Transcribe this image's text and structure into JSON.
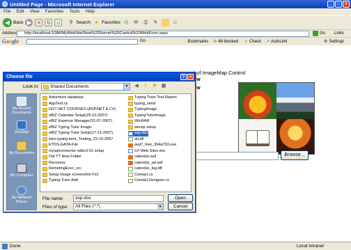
{
  "window": {
    "title": "Untitled Page - Microsoft Internet Explorer"
  },
  "menu": [
    "File",
    "Edit",
    "View",
    "Favorites",
    "Tools",
    "Help"
  ],
  "toolbar": {
    "back": "Back",
    "search": "Search",
    "favorites": "Favorites"
  },
  "address": {
    "label": "Address",
    "url": "http://localhost:1084/MyWebSite/New%20Server%20Control%20WebForm.aspx",
    "go": "Go",
    "links": "Links"
  },
  "google": {
    "logo": "Google",
    "go": "Go",
    "bookmarks": "Bookmarks",
    "blocked": "48 blocked",
    "check": "Check",
    "autolink": "AutoLink",
    "settings": "Settings"
  },
  "page": {
    "heading": "t of ImageMap Control",
    "browse": "Browse..."
  },
  "status": {
    "text": "Done",
    "zone": "Local intranet"
  },
  "dialog": {
    "title": "Choose file",
    "look_in_label": "Look in:",
    "look_in_value": "Shared Documents",
    "places": [
      "My Recent Documents",
      "Desktop",
      "My Documents",
      "My Computer",
      "My Network Places"
    ],
    "files_col1": [
      {
        "name": "Adventure database",
        "type": "folder"
      },
      {
        "name": "AppTest.cs",
        "type": "folder"
      },
      {
        "name": "DOT NET COURSES (ASP.NET & C#)",
        "type": "folder"
      },
      {
        "name": "eBIZ Calendar Setup(29-10-2007)",
        "type": "folder"
      },
      {
        "name": "eBIZ Expense Manager(31-07-2007)",
        "type": "folder"
      },
      {
        "name": "eBIZ Typing Tutor Image",
        "type": "folder"
      },
      {
        "name": "eBIZ Typing Tutor Setup(17-11-2007)",
        "type": "folder"
      },
      {
        "name": "ebiz-typing tutor_Testing_22-10-2007",
        "type": "folder"
      },
      {
        "name": "ETDS-GATA-File",
        "type": "folder"
      },
      {
        "name": "mysqlconnector-odbc3.51 setup",
        "type": "folder"
      },
      {
        "name": "Old TT New Folder",
        "type": "folder"
      },
      {
        "name": "Recovery",
        "type": "folder"
      },
      {
        "name": "RemotingExec_src",
        "type": "folder"
      },
      {
        "name": "Setup Image screenshot Fx2",
        "type": "folder"
      },
      {
        "name": "Typing Tutor Add",
        "type": "folder"
      }
    ],
    "files_col2": [
      {
        "name": "Typing Tutor Test Report",
        "type": "folder",
        "selected": false
      },
      {
        "name": "typing_send",
        "type": "folder",
        "selected": false
      },
      {
        "name": "TypingImage",
        "type": "folder",
        "selected": false
      },
      {
        "name": "TypingTutorImage",
        "type": "folder",
        "selected": false
      },
      {
        "name": "WinRAR",
        "type": "folder",
        "selected": false
      },
      {
        "name": "winzip setup",
        "type": "folder",
        "selected": false
      },
      {
        "name": "asp.doc",
        "type": "doc",
        "selected": true
      },
      {
        "name": "atl.dll",
        "type": "cs",
        "selected": false
      },
      {
        "name": "avg7_free_394a763.exe",
        "type": "ppt",
        "selected": false
      },
      {
        "name": "C# Web Sites.doc",
        "type": "doc",
        "selected": false
      },
      {
        "name": "calendar.swf",
        "type": "ppt",
        "selected": false
      },
      {
        "name": "calendar_ad.swf",
        "type": "ppt",
        "selected": false
      },
      {
        "name": "calendar_log.ldf",
        "type": "cs",
        "selected": false
      },
      {
        "name": "Contact.cs",
        "type": "cs",
        "selected": false
      },
      {
        "name": "Contact.Designer.cs",
        "type": "cs",
        "selected": false
      }
    ],
    "file_name_label": "File name:",
    "file_name_value": "asp.doc",
    "file_type_label": "Files of type:",
    "file_type_value": "All Files (*.*)",
    "open_label": "Open",
    "cancel_label": "Cancel"
  }
}
